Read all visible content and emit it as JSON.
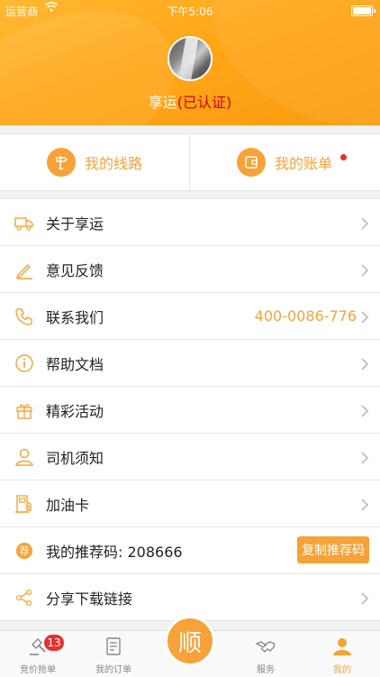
{
  "status": {
    "carrier": "运营商",
    "time": "下午5:06"
  },
  "profile": {
    "name": "享运",
    "certified": "(已认证)"
  },
  "quick": {
    "routes": "我的线路",
    "bills": "我的账单"
  },
  "menu": [
    {
      "label": "关于享运",
      "icon": "truck-icon"
    },
    {
      "label": "意见反馈",
      "icon": "pencil-icon"
    },
    {
      "label": "联系我们",
      "icon": "phone-icon",
      "value": "400-0086-776"
    },
    {
      "label": "帮助文档",
      "icon": "info-icon"
    },
    {
      "label": "精彩活动",
      "icon": "gift-icon"
    },
    {
      "label": "司机须知",
      "icon": "user-icon"
    },
    {
      "label": "加油卡",
      "icon": "gas-station-icon"
    },
    {
      "label": "我的推荐码: 208666",
      "icon": "referral-icon",
      "button": "复制推荐码",
      "icon_text": "荐"
    },
    {
      "label": "分享下载链接",
      "icon": "share-icon"
    }
  ],
  "tabs": [
    {
      "label": "竞价抢单",
      "icon": "gavel-icon",
      "badge": "13"
    },
    {
      "label": "我的订单",
      "icon": "document-icon"
    },
    {
      "label": "顺",
      "icon": "center-action-icon"
    },
    {
      "label": "服务",
      "icon": "handshake-icon"
    },
    {
      "label": "我的",
      "icon": "person-icon"
    }
  ],
  "colors": {
    "accent": "#f7a238",
    "header": "#ffa617",
    "alert": "#e8302c",
    "certified": "#d0021b"
  }
}
